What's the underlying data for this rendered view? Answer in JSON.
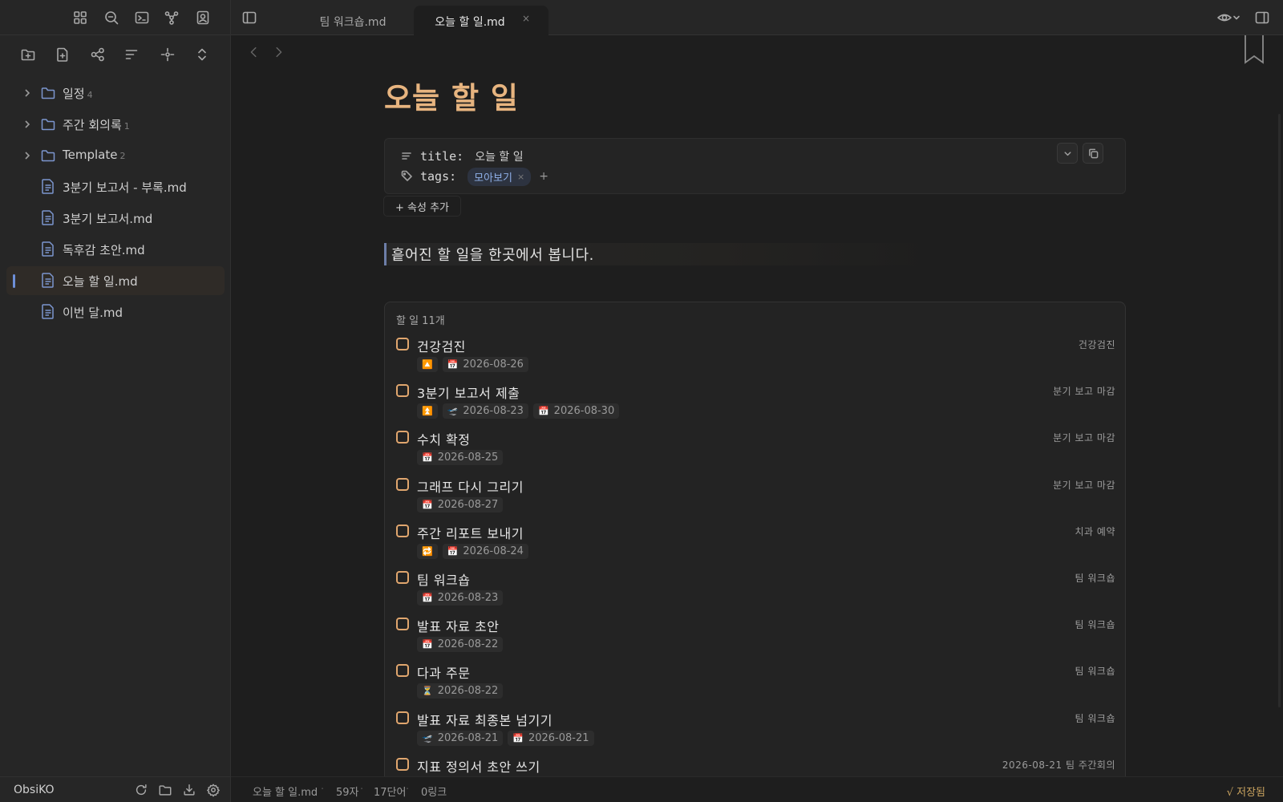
{
  "ribbon_icons": [
    "dashboard-icon",
    "search-icon",
    "terminal-icon",
    "graph-icon",
    "profile-icon"
  ],
  "explorer_tools": [
    "new-folder-icon",
    "new-file-icon",
    "graph-view-icon",
    "sort-icon",
    "locate-icon",
    "expand-collapse-icon"
  ],
  "tree": [
    {
      "type": "folder",
      "label": "일정",
      "count": "4"
    },
    {
      "type": "folder",
      "label": "주간 회의록",
      "count": "1"
    },
    {
      "type": "folder",
      "label": "Template",
      "count": "2"
    },
    {
      "type": "file",
      "label": "3분기 보고서 - 부록.md"
    },
    {
      "type": "file",
      "label": "3분기 보고서.md"
    },
    {
      "type": "file",
      "label": "독후감 초안.md"
    },
    {
      "type": "file",
      "label": "오늘 할 일.md",
      "active": true
    },
    {
      "type": "file",
      "label": "이번 달.md"
    }
  ],
  "vault": {
    "name": "ObsiKO"
  },
  "tabs": [
    {
      "label": "팀 워크숍.md",
      "close": "×"
    },
    {
      "label": "오늘 할 일.md",
      "close": "×",
      "active": true
    }
  ],
  "note": {
    "title": "오늘 할 일",
    "properties": {
      "title_key": "title:",
      "title_value": "오늘 할 일",
      "tags_key": "tags:",
      "tag": "모아보기",
      "tag_remove": "×",
      "tag_add": "+"
    },
    "add_property": "+ 속성 추가",
    "callout": "흩어진 할 일을 한곳에서 봅니다."
  },
  "tasks": {
    "count_label": "할 일 11개",
    "items": [
      {
        "name": "건강검진",
        "source": "건강검진",
        "meta": [
          {
            "emoji": "🔼",
            "text": ""
          },
          {
            "emoji": "📅",
            "text": "2026-08-26"
          }
        ]
      },
      {
        "name": "3분기 보고서 제출",
        "source": "분기 보고 마감",
        "meta": [
          {
            "emoji": "⏫",
            "text": ""
          },
          {
            "emoji": "🛫",
            "text": "2026-08-23"
          },
          {
            "emoji": "📅",
            "text": "2026-08-30"
          }
        ]
      },
      {
        "name": "수치 확정",
        "source": "분기 보고 마감",
        "meta": [
          {
            "emoji": "📅",
            "text": "2026-08-25"
          }
        ]
      },
      {
        "name": "그래프 다시 그리기",
        "source": "분기 보고 마감",
        "meta": [
          {
            "emoji": "📅",
            "text": "2026-08-27"
          }
        ]
      },
      {
        "name": "주간 리포트 보내기",
        "source": "치과 예약",
        "meta": [
          {
            "emoji": "🔁",
            "text": ""
          },
          {
            "emoji": "📅",
            "text": "2026-08-24"
          }
        ]
      },
      {
        "name": "팀 워크숍",
        "source": "팀 워크숍",
        "meta": [
          {
            "emoji": "📅",
            "text": "2026-08-23"
          }
        ]
      },
      {
        "name": "발표 자료 초안",
        "source": "팀 워크숍",
        "meta": [
          {
            "emoji": "📅",
            "text": "2026-08-22"
          }
        ]
      },
      {
        "name": "다과 주문",
        "source": "팀 워크숍",
        "meta": [
          {
            "emoji": "⏳",
            "text": "2026-08-22"
          }
        ]
      },
      {
        "name": "발표 자료 최종본 넘기기",
        "source": "팀 워크숍",
        "meta": [
          {
            "emoji": "🛫",
            "text": "2026-08-21"
          },
          {
            "emoji": "📅",
            "text": "2026-08-21"
          }
        ]
      },
      {
        "name": "지표 정의서 초안 쓰기",
        "source": "2026-08-21 팀 주간회의",
        "meta": []
      }
    ]
  },
  "status": {
    "file": "오늘 할 일.md",
    "chars": "59자",
    "words": "17단어",
    "links": "0링크",
    "saved": "√ 저장됨"
  },
  "colors": {
    "accent": "#e7b47f",
    "folder_icon": "#7c96cf",
    "checkbox": "#e0a66e",
    "tag": "#8fb0e8"
  }
}
